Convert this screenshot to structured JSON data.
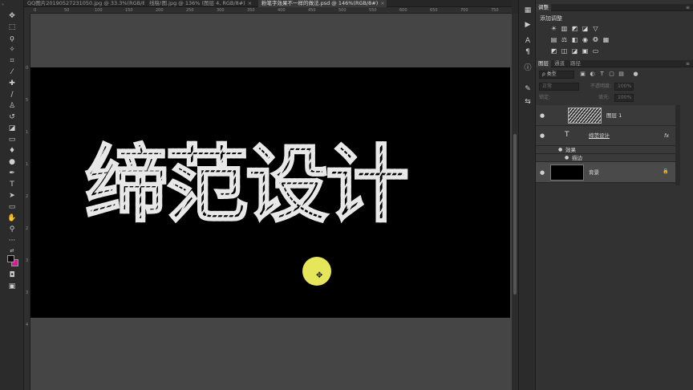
{
  "tabs": [
    {
      "label": "QQ图片20190527231050.jpg @ 33.3%(RGB/8#)",
      "close": "×"
    },
    {
      "label": "线稿!图.jpg @ 136% (图层 4, RGB/8#)",
      "close": "×"
    },
    {
      "label": "粉笔字效果不一样的做法.psd @ 146%(RGB/8#)",
      "close": "×"
    }
  ],
  "ruler_top_ticks": [
    "0",
    "50",
    "100",
    "150",
    "200",
    "250",
    "300",
    "350",
    "400",
    "450",
    "500",
    "550",
    "600",
    "650",
    "700",
    "750"
  ],
  "ruler_left_ticks": [
    "0",
    "5",
    "1",
    "1",
    "2",
    "2",
    "3",
    "3",
    "4"
  ],
  "canvas": {
    "title": "缔范设计",
    "canvas_color": "#000000",
    "stroke_color": "#e8e8e8",
    "cursor_color": "#e6e65a"
  },
  "colors": {
    "foreground": "#0b0b0b",
    "background": "#e0139a"
  },
  "adjustments": {
    "tab": "调整",
    "title": "添加调整",
    "menu": "≡"
  },
  "layers_panel": {
    "tabs": [
      "图层",
      "通道",
      "路径"
    ],
    "menu": "≡",
    "filter_kind": "ρ 类型",
    "blend_mode": "正常",
    "opacity_label": "不透明度:",
    "opacity_value": "100%",
    "lock_label": "锁定:",
    "fill_label": "填充:",
    "fill_value": "100%",
    "layers": [
      {
        "name": "图层 1",
        "type": "pixel",
        "visible_icon": "●"
      },
      {
        "name": "缔范设计",
        "type": "text",
        "type_glyph": "T",
        "fx": "fx",
        "visible_icon": "●"
      },
      {
        "name": "效果",
        "type": "effects",
        "visible_icon": "●"
      },
      {
        "name": "描边",
        "type": "effect",
        "visible_icon": "●"
      },
      {
        "name": "背景",
        "type": "background",
        "visible_icon": "●",
        "lock_glyph": "🔒"
      }
    ]
  }
}
